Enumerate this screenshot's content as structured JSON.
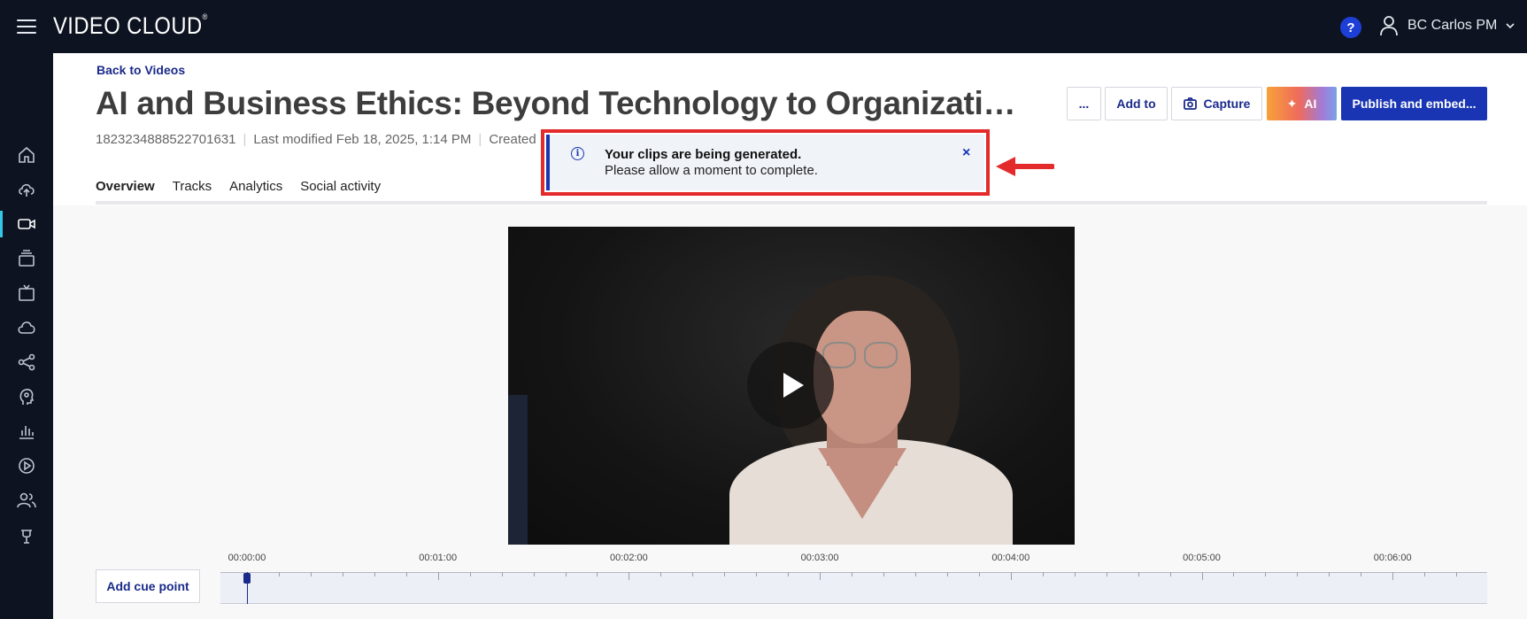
{
  "app": {
    "logo_text": "VIDEO CLOUD",
    "logo_mark": "®"
  },
  "topbar": {
    "help_label": "?",
    "user_name": "BC Carlos PM"
  },
  "sidebar": {
    "items": [
      {
        "icon": "home-icon",
        "active": false
      },
      {
        "icon": "upload-icon",
        "active": false
      },
      {
        "icon": "video-camera-icon",
        "active": true
      },
      {
        "icon": "media-library-icon",
        "active": false
      },
      {
        "icon": "tv-icon",
        "active": false
      },
      {
        "icon": "cloud-icon",
        "active": false
      },
      {
        "icon": "share-icon",
        "active": false
      },
      {
        "icon": "ai-head-icon",
        "active": false
      },
      {
        "icon": "analytics-icon",
        "active": false
      },
      {
        "icon": "player-icon",
        "active": false
      },
      {
        "icon": "users-icon",
        "active": false
      },
      {
        "icon": "plugin-icon",
        "active": false
      }
    ]
  },
  "header": {
    "back_link": "Back to Videos",
    "title": "AI and Business Ethics: Beyond Technology to Organizational ...",
    "video_id": "1823234888522701631",
    "last_modified": "Last modified Feb 18, 2025, 1:14 PM",
    "created": "Created"
  },
  "actions": {
    "more_label": "...",
    "add_to_label": "Add to",
    "capture_label": "Capture",
    "ai_label": "AI",
    "publish_label": "Publish and embed..."
  },
  "tabs": [
    {
      "label": "Overview",
      "active": true
    },
    {
      "label": "Tracks",
      "active": false
    },
    {
      "label": "Analytics",
      "active": false
    },
    {
      "label": "Social activity",
      "active": false
    }
  ],
  "toast": {
    "title": "Your clips are being generated.",
    "message": "Please allow a moment to complete.",
    "close_label": "×",
    "info_glyph": "i"
  },
  "timeline": {
    "cue_button_label": "Add cue point",
    "labels": [
      "00:00:00",
      "00:01:00",
      "00:02:00",
      "00:03:00",
      "00:04:00",
      "00:05:00",
      "00:06:00"
    ],
    "playhead_time": "00:00:00"
  },
  "colors": {
    "nav_bg": "#0d1321",
    "accent": "#1935b4",
    "highlight_frame": "#e42b2b",
    "active_indicator": "#32c8e6"
  }
}
